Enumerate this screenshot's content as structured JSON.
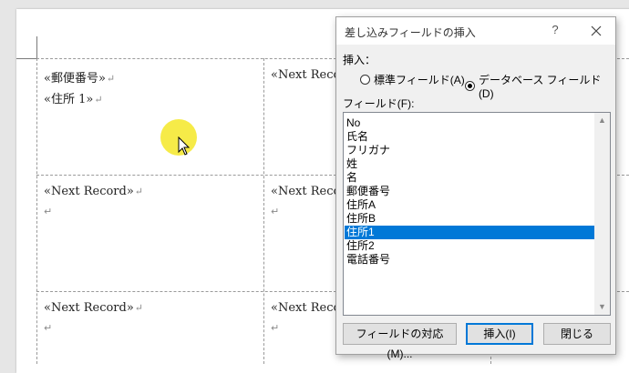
{
  "document": {
    "cell1": {
      "line1": "«郵便番号»",
      "line2": "«住所 1»"
    },
    "next_record": "«Next Record»",
    "next_record_short": "«Next Reco",
    "paragraph_mark": "↵"
  },
  "dialog": {
    "title": "差し込みフィールドの挿入",
    "help": "?",
    "insert_label": "挿入：",
    "radio_standard": "標準フィールド(A)",
    "radio_database": "データベース フィールド(D)",
    "radio_selected": "database",
    "fields_label": "フィールド(F):",
    "fields": [
      "No",
      "氏名",
      "フリガナ",
      "姓",
      "名",
      "郵便番号",
      "住所A",
      "住所B",
      "住所1",
      "住所2",
      "電話番号"
    ],
    "selected_field": "住所1",
    "buttons": {
      "match_fields": "フィールドの対応(M)...",
      "insert": "挿入(I)",
      "close": "閉じる"
    }
  },
  "colors": {
    "selection": "#0078d7",
    "cursor_highlight": "#f5e828"
  },
  "icons": [
    "close-icon",
    "scroll-up-icon",
    "scroll-down-icon",
    "mouse-pointer-icon"
  ]
}
